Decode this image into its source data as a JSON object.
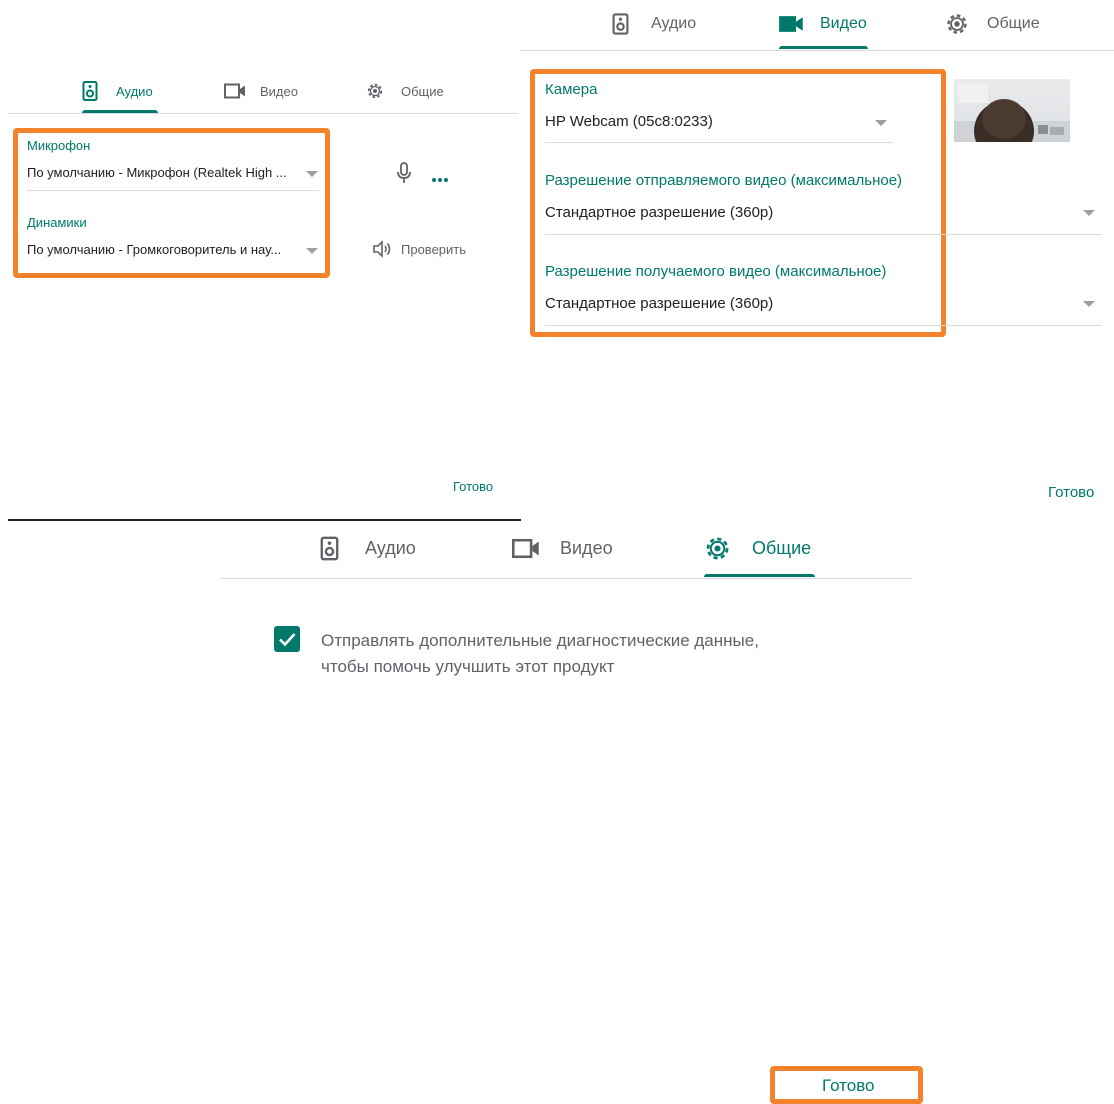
{
  "panel_audio": {
    "tabs": [
      "Аудио",
      "Видео",
      "Общие"
    ],
    "mic_label": "Микрофон",
    "mic_value": "По умолчанию - Микрофон (Realtek High ...",
    "speaker_label": "Динамики",
    "speaker_value": "По умолчанию - Громкоговоритель и нау...",
    "check_label": "Проверить",
    "done": "Готово"
  },
  "panel_video": {
    "tabs": [
      "Аудио",
      "Видео",
      "Общие"
    ],
    "camera_label": "Камера",
    "camera_value": "HP Webcam (05c8:0233)",
    "send_label": "Разрешение отправляемого видео (максимальное)",
    "send_value": "Стандартное разрешение (360p)",
    "recv_label": "Разрешение получаемого видео (максимальное)",
    "recv_value": "Стандартное разрешение (360p)",
    "done": "Готово"
  },
  "panel_general": {
    "tabs": [
      "Аудио",
      "Видео",
      "Общие"
    ],
    "diag_line1": "Отправлять дополнительные диагностические данные,",
    "diag_line2": "чтобы помочь улучшить этот продукт",
    "diag_checked": true,
    "done": "Готово"
  },
  "colors": {
    "accent": "#00796b",
    "highlight": "#f4822a"
  }
}
